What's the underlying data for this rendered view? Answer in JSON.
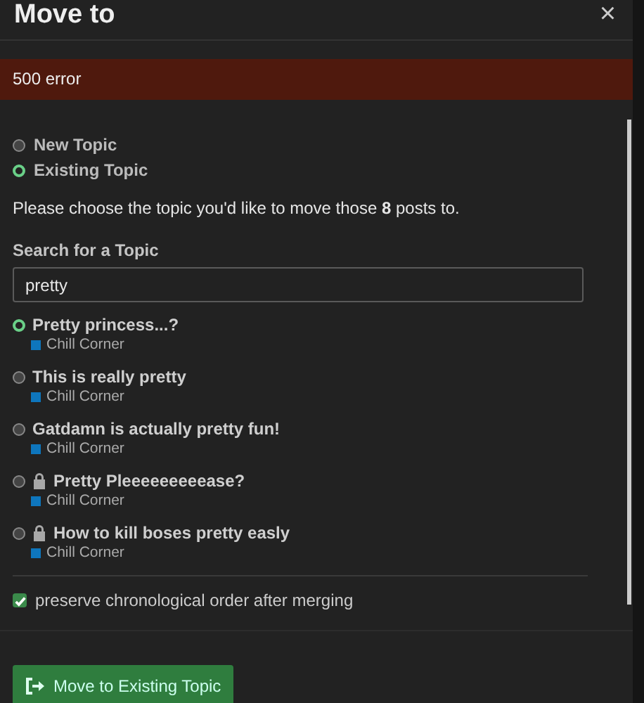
{
  "modal": {
    "title": "Move to",
    "close": "×"
  },
  "error": "500 error",
  "modes": [
    {
      "label": "New Topic",
      "selected": false
    },
    {
      "label": "Existing Topic",
      "selected": true
    }
  ],
  "instructions": "Please choose the topic you'd like to move those **8** posts to.",
  "search": {
    "label": "Search for a Topic",
    "value": "pretty"
  },
  "topics": [
    {
      "title": "Pretty princess...?",
      "selected": true,
      "locked": false,
      "category": {
        "name": "Chill Corner",
        "color": "#0e76bd"
      }
    },
    {
      "title": "This is really pretty",
      "selected": false,
      "locked": false,
      "category": {
        "name": "Chill Corner",
        "color": "#0e76bd"
      }
    },
    {
      "title": "Gatdamn is actually pretty fun!",
      "selected": false,
      "locked": false,
      "category": {
        "name": "Chill Corner",
        "color": "#0e76bd"
      }
    },
    {
      "title": "Pretty Pleeeeeeeeease?",
      "selected": false,
      "locked": true,
      "category": {
        "name": "Chill Corner",
        "color": "#0e76bd"
      }
    },
    {
      "title": "How to kill boses pretty easly",
      "selected": false,
      "locked": true,
      "category": {
        "name": "Chill Corner",
        "color": "#0e76bd"
      }
    }
  ],
  "preserve_order": {
    "label": "preserve chronological order after merging",
    "checked": true
  },
  "submit": {
    "label": "Move to Existing Topic"
  }
}
